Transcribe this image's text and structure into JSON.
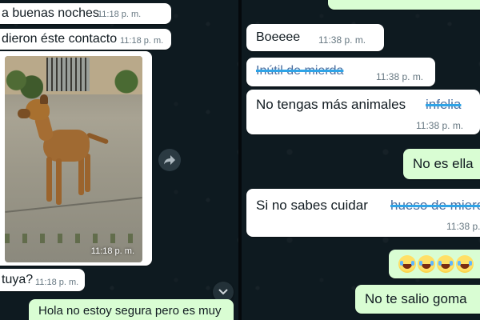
{
  "left_chat": {
    "messages": [
      {
        "text": "a buenas noches",
        "time": "11:18 p. m."
      },
      {
        "text": "dieron éste contacto",
        "time": "11:18 p. m."
      },
      {
        "photo_time": "11:18 p. m."
      },
      {
        "text": "tuya?",
        "time": "11:18 p. m."
      },
      {
        "text": "Hola no estoy segura pero es muy"
      }
    ],
    "forward_icon": "forward-icon",
    "scroll_icon": "chevron-down-icon"
  },
  "right_chat": {
    "messages": [
      {
        "text": "Boeeee",
        "time": "11:38 p. m."
      },
      {
        "strike_text": "Inútil de mierda",
        "time": "11:38 p. m."
      },
      {
        "text": "No tengas más animales",
        "strike_text": "infelia",
        "time": "11:38 p. m."
      },
      {
        "text": "No es ella"
      },
      {
        "text": "Si no sabes cuidar",
        "strike_text": "hueso de mierd",
        "time": "11:38 p."
      },
      {
        "emoji": "😂😂😂😂"
      },
      {
        "text": "No te salio goma"
      }
    ]
  },
  "colors": {
    "incoming": "#ffffff",
    "outgoing": "#d9fdd3",
    "background": "#0e1a20",
    "strike": "#2fa4e7"
  }
}
